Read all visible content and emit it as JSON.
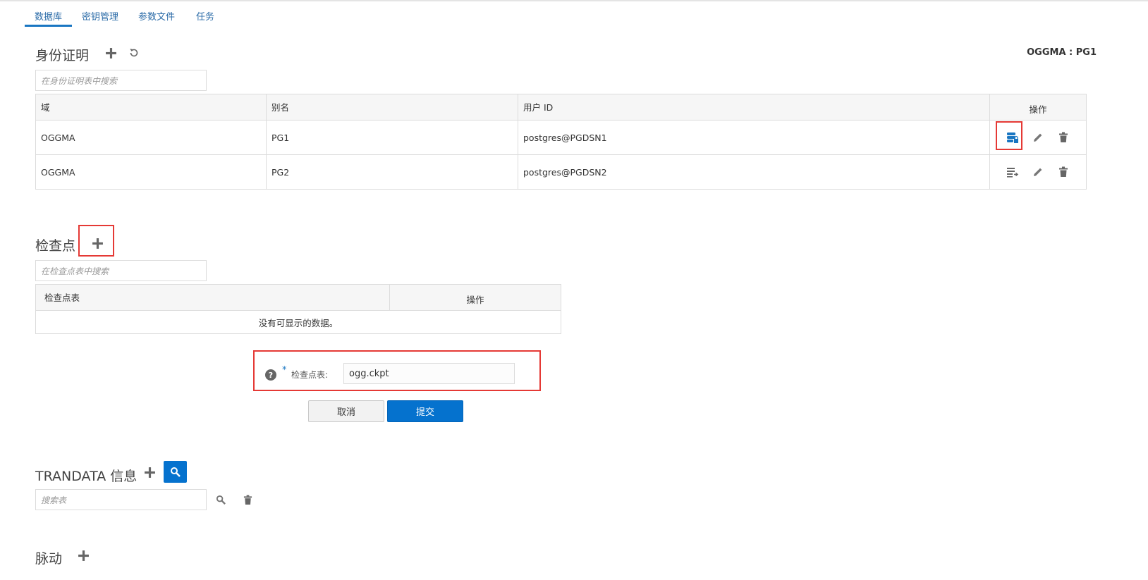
{
  "tabs": [
    {
      "label": "数据库",
      "active": true
    },
    {
      "label": "密钥管理"
    },
    {
      "label": "参数文件"
    },
    {
      "label": "任务"
    }
  ],
  "context_label": "OGGMA : PG1",
  "credentials": {
    "title": "身份证明",
    "search_placeholder": "在身份证明表中搜索",
    "columns": [
      "域",
      "别名",
      "用户 ID",
      "操作"
    ],
    "rows": [
      {
        "domain": "OGGMA",
        "alias": "PG1",
        "user_id": "postgres@PGDSN1"
      },
      {
        "domain": "OGGMA",
        "alias": "PG2",
        "user_id": "postgres@PGDSN2"
      }
    ]
  },
  "checkpoint": {
    "title": "检查点",
    "search_placeholder": "在检查点表中搜索",
    "columns": [
      "检查点表",
      "操作"
    ],
    "empty_text": "没有可显示的数据。",
    "form": {
      "required_mark": "*",
      "label": "检查点表:",
      "value": "ogg.ckpt",
      "cancel_label": "取消",
      "submit_label": "提交"
    }
  },
  "trandata": {
    "title": "TRANDATA 信息",
    "search_placeholder": "搜索表"
  },
  "heartbeat": {
    "title": "脉动"
  },
  "colors": {
    "accent": "#0572ce",
    "highlight": "#e53935",
    "tab_text": "#2c6ca8"
  },
  "icons": [
    "plus-icon",
    "refresh-icon",
    "db-lock-icon",
    "edit-icon",
    "trash-icon",
    "list-arrow-icon",
    "search-icon",
    "help-icon"
  ]
}
